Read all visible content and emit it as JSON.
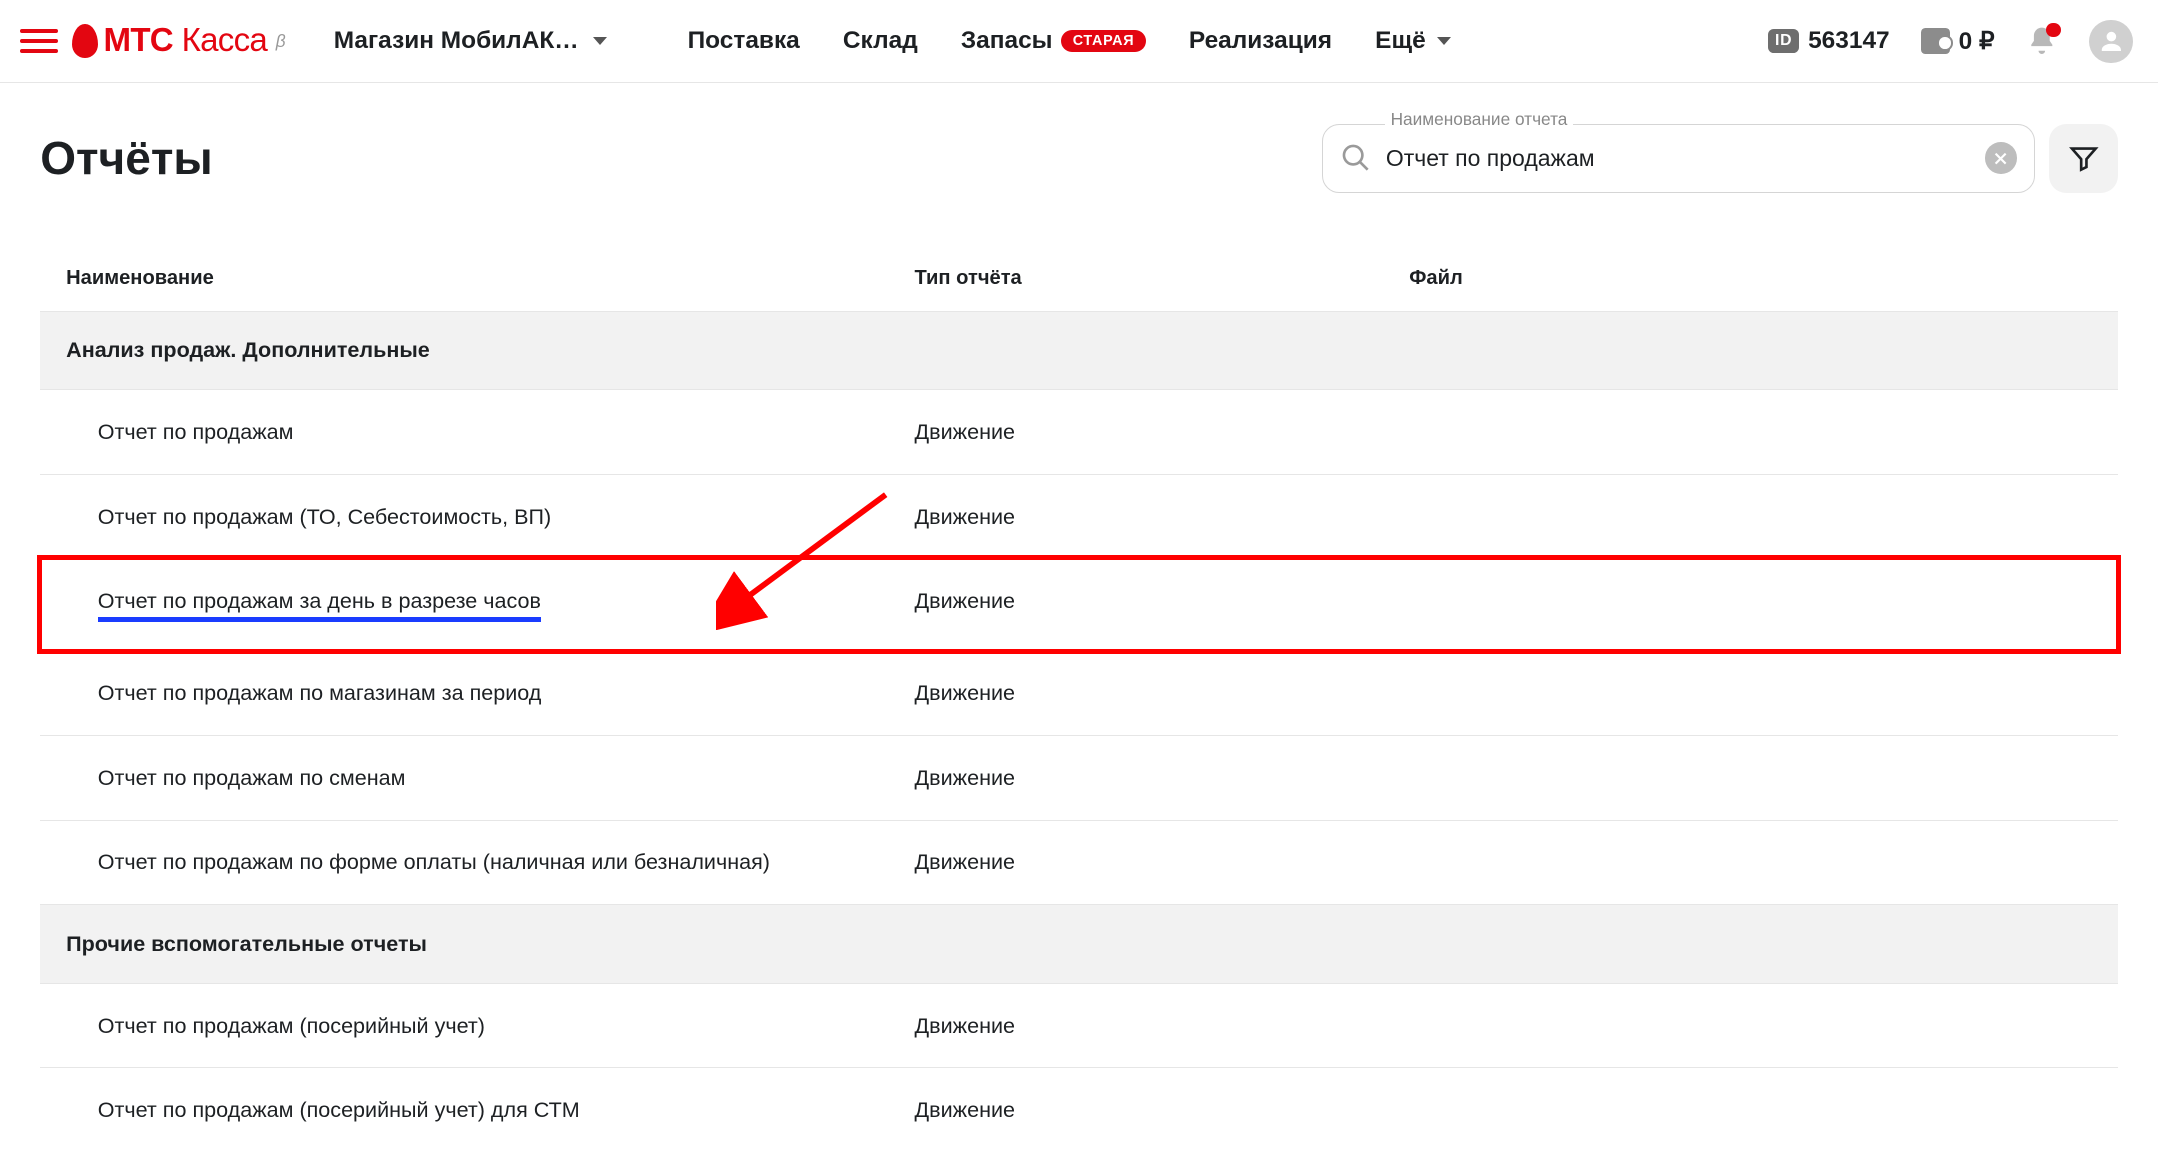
{
  "header": {
    "brand_primary": "МТС",
    "brand_secondary": "Касса",
    "brand_beta": "β",
    "store_name": "Магазин МобилАК…",
    "nav": {
      "supply": "Поставка",
      "warehouse": "Склад",
      "stock": "Запасы",
      "stock_badge": "СТАРАЯ",
      "sales": "Реализация",
      "more": "Ещё"
    },
    "id_label": "ID",
    "id_value": "563147",
    "balance": "0 ₽"
  },
  "page": {
    "title": "Отчёты",
    "search_label": "Наименование отчета",
    "search_value": "Отчет по продажам"
  },
  "table": {
    "columns": {
      "name": "Наименование",
      "type": "Тип отчёта",
      "file": "Файл"
    },
    "sections": [
      {
        "title": "Анализ продаж. Дополнительные",
        "rows": [
          {
            "name": "Отчет по продажам",
            "type": "Движение",
            "highlight": false
          },
          {
            "name": "Отчет по продажам (ТО, Себестоимость, ВП)",
            "type": "Движение",
            "highlight": false
          },
          {
            "name": "Отчет по продажам за день в разрезе часов",
            "type": "Движение",
            "highlight": true
          },
          {
            "name": "Отчет по продажам по магазинам за период",
            "type": "Движение",
            "highlight": false
          },
          {
            "name": "Отчет по продажам по сменам",
            "type": "Движение",
            "highlight": false
          },
          {
            "name": "Отчет по продажам по форме оплаты (наличная или безналичная)",
            "type": "Движение",
            "highlight": false
          }
        ]
      },
      {
        "title": "Прочие вспомогательные отчеты",
        "rows": [
          {
            "name": "Отчет по продажам (посерийный учет)",
            "type": "Движение",
            "highlight": false
          },
          {
            "name": "Отчет по продажам (посерийный учет) для СТМ",
            "type": "Движение",
            "highlight": false
          }
        ]
      }
    ]
  }
}
